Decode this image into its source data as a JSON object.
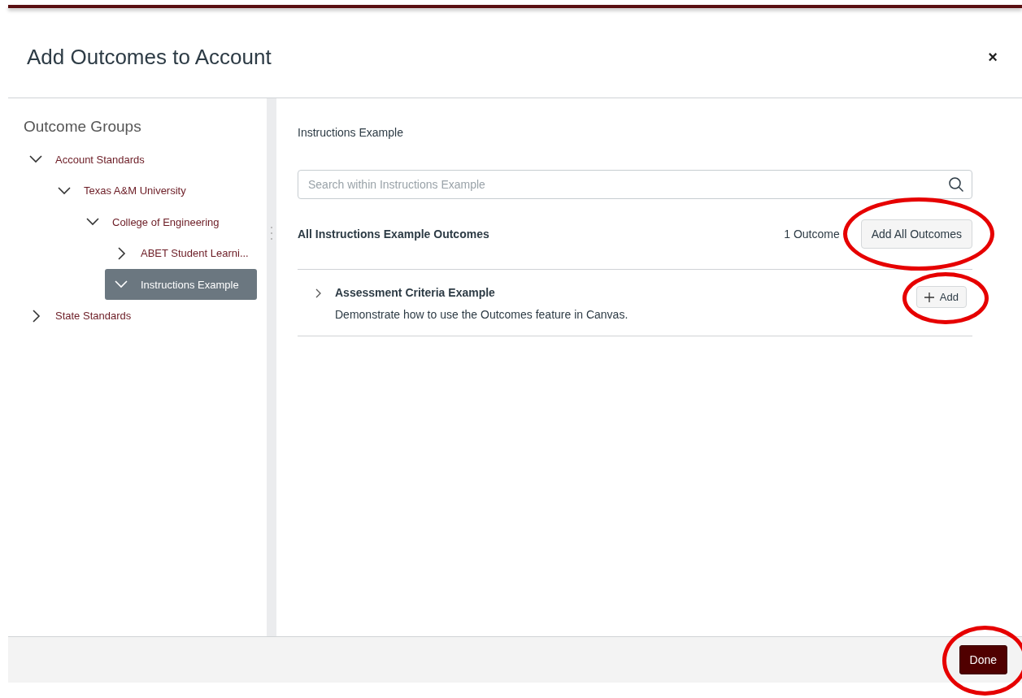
{
  "dialog": {
    "title": "Add Outcomes to Account",
    "close": "×"
  },
  "sidebar": {
    "heading": "Outcome Groups",
    "tree": [
      {
        "label": "Account Standards",
        "expanded": true,
        "selected": false,
        "children": [
          {
            "label": "Texas A&M University",
            "expanded": true,
            "selected": false,
            "children": [
              {
                "label": "College of Engineering",
                "expanded": true,
                "selected": false,
                "children": [
                  {
                    "label": "ABET Student Learni...",
                    "expanded": false,
                    "selected": false
                  },
                  {
                    "label": "Instructions Example",
                    "expanded": true,
                    "selected": true
                  }
                ]
              }
            ]
          }
        ]
      },
      {
        "label": "State Standards",
        "expanded": false,
        "selected": false
      }
    ]
  },
  "content": {
    "heading": "Instructions Example",
    "search": {
      "placeholder": "Search within Instructions Example"
    },
    "group_title": "All Instructions Example Outcomes",
    "count": "1 Outcome",
    "add_all_button": {
      "label": "Add All Outcomes",
      "annotated": true
    },
    "outcomes": [
      {
        "title": "Assessment Criteria Example",
        "description": "Demonstrate how to use the Outcomes feature in Canvas.",
        "expanded": false,
        "add_button": {
          "label": "Add",
          "annotated": true
        }
      }
    ]
  },
  "footer": {
    "done_button": {
      "label": "Done",
      "annotated": true
    }
  }
}
